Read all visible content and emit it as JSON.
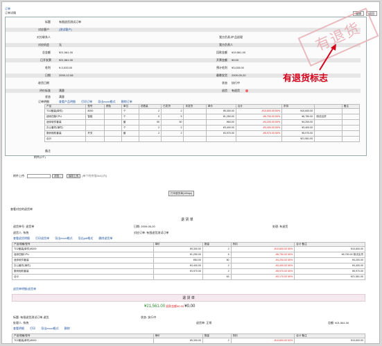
{
  "crumb": "订单",
  "crumb2": "订单详情",
  "buttons": {
    "edit": "编辑",
    "back": "返回"
  },
  "fields": {
    "title_l": "标题",
    "title_v": "有限退货测试订单",
    "customer_l": "对应客户",
    "customer_v": "(测试客户)",
    "contact_l": "对方联系人",
    "contact_r_l": "我方负责人",
    "contact_r_v": "产品经理",
    "opp_l": "对应机会",
    "opp_v": "无",
    "amount_l": "总金额",
    "amount_v": "¥21,561.00",
    "amount_r_l": "回款金额",
    "amount_r_v": "¥19,561.00",
    "paid_l": "已开发票",
    "paid_v": "¥21,561.00",
    "paid_r_l": "开票金额",
    "paid_r_v": "¥0.00",
    "profit_l": "毛利",
    "profit_v": "¥-3,033.00",
    "profit_r_l": "预计毛利",
    "profit_r_v": "¥3,033.00",
    "date_l": "日期",
    "date_v": "2009-12-08",
    "date_r_l": "最晚发货",
    "date_r_v": "2009-05-20",
    "ship_l": "收货日期",
    "ship_r_l": "状态",
    "ship_r_v": "执行中",
    "remark_l": "评价标准",
    "remark_v": "满意",
    "remark_r_l": "退货",
    "remark_r_v": "有退货",
    "state_l": "状态",
    "state_v": "满意",
    "detail_l": "订单明细",
    "memo_l": "备注",
    "att_l": "附件(0个)"
  },
  "detail_links": [
    "查看产品明细",
    "打印订单",
    "导出excel格式",
    "删除订单"
  ],
  "item_header": [
    "产品",
    "型号",
    "颜色",
    "单位",
    "总数量",
    "已发货",
    "未发货",
    "单价",
    "合计",
    "折扣",
    "",
    "备注"
  ],
  "items": [
    [
      "TD2套装(单件)",
      "8000",
      "",
      "个",
      "2",
      "2",
      "",
      "¥5,300.00",
      "-¥10,600.00 50%",
      "¥10,600.00",
      "",
      ""
    ],
    [
      "迷你四核CPU",
      "智能",
      "",
      "个",
      "5",
      "5",
      "",
      "¥1,250.00",
      "-¥6,750.00 50%",
      "¥6,750.00",
      "测试出货",
      ""
    ],
    [
      "迷你软件套装",
      "",
      "",
      "套",
      "50",
      "50",
      "",
      "¥84.00",
      "-¥4,200.00 50%",
      "¥4,200.00",
      "",
      ""
    ],
    [
      "办公套件(单件)",
      "",
      "",
      "个",
      "2",
      "2",
      "",
      "¥3,400.00",
      "-¥3,400.00 50%",
      "¥3,400.00",
      "",
      ""
    ],
    [
      "数码相机套装",
      "开关",
      "",
      "套",
      "2",
      "2",
      "",
      "¥3,970.00",
      "-¥5,970.00 50%",
      "¥5,970.00",
      "",
      ""
    ],
    [
      "合计",
      "",
      "",
      "",
      "",
      "",
      "",
      "",
      "",
      "¥21,561.00",
      "",
      ""
    ]
  ],
  "search": {
    "label": "附件上传:",
    "btn1": "浏览...",
    "btn2": "保存上传",
    "hint": "(单个附件限5M以内)"
  },
  "print_btn": "打印退货单(100dpi)",
  "section2_title": "查看对应的退货单",
  "ret_title": "退 货 单",
  "ret_fields": [
    "退货单号: 退货单",
    "日期: 2009-05-20",
    "处理: 有退货",
    "退货人: 系统",
    "对应订单: 有限退货测试订单"
  ],
  "ret_links": [
    "查看退货明细",
    "打印退货单",
    "导出excel格式",
    "导出pdf格式",
    "删除退货单"
  ],
  "ret_header": [
    "产品/规格/型号",
    "单价",
    "数量",
    "折扣",
    "合计 备注"
  ],
  "ret_items": [
    [
      "TD2套装(单件)/8000",
      "¥5,300.00",
      "2",
      "-¥10,600.00 50%",
      "¥10,600.00"
    ],
    [
      "迷你四核CPU",
      "¥1,250.00",
      "5",
      "-¥6,750.00 50%",
      "¥6,750.00 测试出货"
    ],
    [
      "迷你软件套装",
      "¥84.00",
      "50",
      "-¥4,200.00 50%",
      "¥4,200.00"
    ],
    [
      "办公套件(单件)",
      "¥3,400.00",
      "2",
      "-¥3,400.00 50%",
      "¥3,400.00"
    ],
    [
      "数码相机套装",
      "¥3,970.00",
      "2",
      "-¥5,970.00 50%",
      "¥5,970.00"
    ],
    [
      "合计",
      "",
      "63",
      "-¥3,170.00 50%",
      "¥21,561.00"
    ]
  ],
  "ret2_link": "退货单明细/退货单",
  "pink": {
    "title": "退 货 单",
    "amount": "¥21,561.00",
    "mid": "退款金额¥0.00",
    "paid": "¥0.00"
  },
  "bottom_fields": [
    "标题: 有限退货测试订单-退货",
    "状态: 执行中",
    "处理人: 系统",
    "退货单: 正常",
    "总额: ¥21,561.00"
  ],
  "bottom_links": [
    "查看明细",
    "打印",
    "导出excel格式",
    "删除"
  ],
  "annotation": "有退货标志",
  "stamp": "有退货"
}
